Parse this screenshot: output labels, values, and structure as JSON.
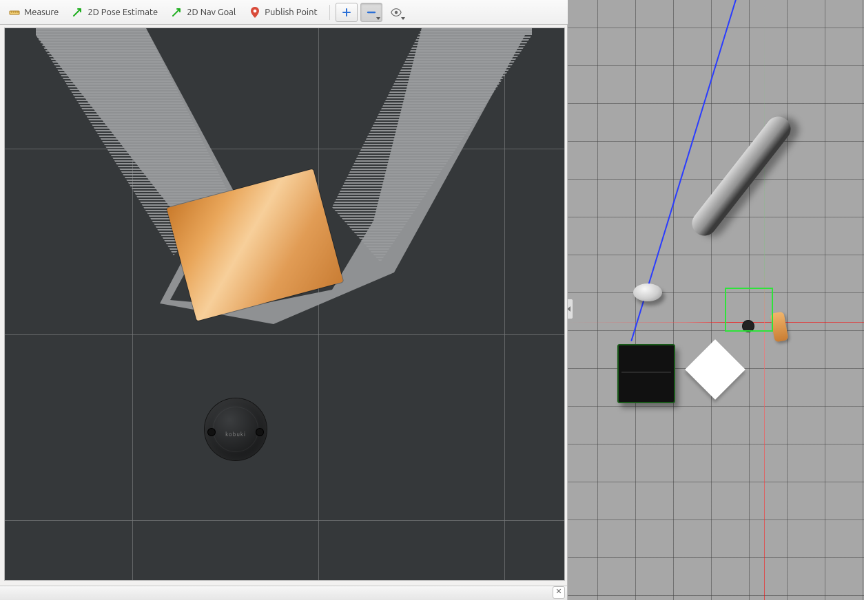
{
  "toolbar": {
    "measure_label": "Measure",
    "pose_estimate_label": "2D Pose Estimate",
    "nav_goal_label": "2D Nav Goal",
    "publish_point_label": "Publish Point"
  },
  "icons": {
    "measure": "ruler-icon",
    "pose_estimate": "arrow-green-icon",
    "nav_goal": "arrow-green-icon",
    "publish_point": "pin-icon",
    "add": "plus-icon",
    "remove": "minus-icon",
    "visibility": "eye-icon",
    "close": "close-icon",
    "collapse_handle": "collapse-left-icon"
  },
  "rviz": {
    "robot_label": "kobuki"
  },
  "colors": {
    "rviz_bg": "#35383a",
    "gazebo_bg": "#a7a7a7",
    "selection_green": "#2ee33a",
    "ray_blue": "#2a3cff",
    "table_orange": "#e19c55"
  },
  "gazebo": {
    "objects": [
      "long_cylinder",
      "small_puck",
      "dumpster",
      "white_diamond",
      "wood_table",
      "turtlebot"
    ],
    "selection_active": true
  }
}
